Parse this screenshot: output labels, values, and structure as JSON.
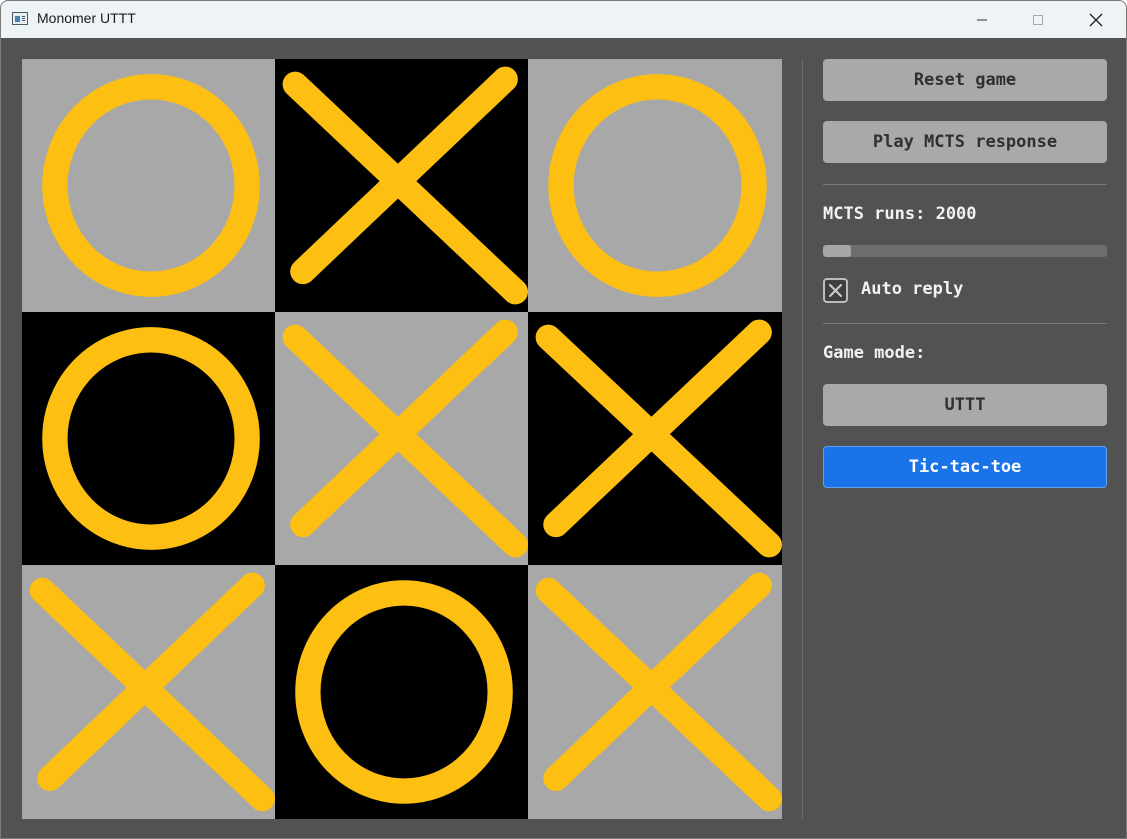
{
  "window": {
    "title": "Monomer UTTT"
  },
  "board": {
    "cells": [
      {
        "mark": "O",
        "shade": "light"
      },
      {
        "mark": "X",
        "shade": "dark"
      },
      {
        "mark": "O",
        "shade": "light"
      },
      {
        "mark": "O",
        "shade": "dark"
      },
      {
        "mark": "X",
        "shade": "light"
      },
      {
        "mark": "X",
        "shade": "dark"
      },
      {
        "mark": "X",
        "shade": "light"
      },
      {
        "mark": "O",
        "shade": "dark"
      },
      {
        "mark": "X",
        "shade": "light"
      }
    ],
    "mark_color": "#fcbf12",
    "light_color": "#a8a8a8",
    "dark_color": "#000000"
  },
  "controls": {
    "reset_label": "Reset game",
    "play_label": "Play MCTS response",
    "runs_label": "MCTS runs: 2000",
    "runs_slider_fraction": 0.1,
    "auto_reply_label": "Auto reply",
    "auto_reply_checked": true,
    "game_mode_label": "Game mode:",
    "mode_options": [
      "UTTT",
      "Tic-tac-toe"
    ],
    "selected_mode": "Tic-tac-toe",
    "accent_color": "#1a73e8"
  }
}
